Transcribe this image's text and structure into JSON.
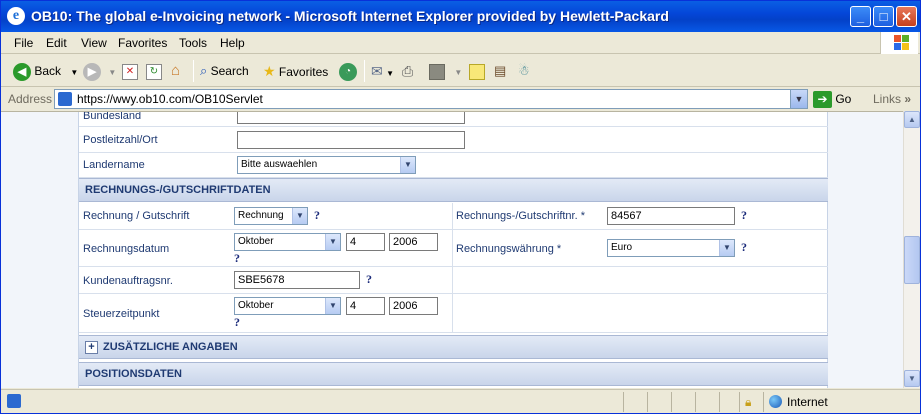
{
  "window": {
    "title": "OB10: The global e-Invoicing network - Microsoft Internet Explorer provided by Hewlett-Packard",
    "minimize": "_",
    "maximize": "□",
    "close": "✕"
  },
  "menu": [
    "File",
    "Edit",
    "View",
    "Favorites",
    "Tools",
    "Help"
  ],
  "toolbar": {
    "back": "Back",
    "search": "Search",
    "favorites": "Favorites"
  },
  "address": {
    "label": "Address",
    "url": "https://wwy.ob10.com/OB10Servlet",
    "go": "Go",
    "links": "Links"
  },
  "form": {
    "bundesland_label": "Bundesland",
    "bundesland_value": "",
    "plz_label": "Postleitzahl/Ort",
    "plz_value": "",
    "laender_label": "Landername",
    "laender_value": "Bitte auswaehlen",
    "section_rechnung": "RECHNUNGS-/GUTSCHRIFTDATEN",
    "typ_label": "Rechnung / Gutschrift",
    "typ_value": "Rechnung",
    "nr_label": "Rechnungs-/Gutschriftnr. *",
    "nr_value": "84567",
    "datum_label": "Rechnungsdatum",
    "datum_month": "Oktober",
    "datum_day": "4",
    "datum_year": "2006",
    "waehrung_label": "Rechnungswährung *",
    "waehrung_value": "Euro",
    "kunden_label": "Kundenauftragsnr.",
    "kunden_value": "SBE5678",
    "steuer_label": "Steuerzeitpunkt",
    "steuer_month": "Oktober",
    "steuer_day": "4",
    "steuer_year": "2006",
    "help": "?",
    "section_zusatz_plus": "+",
    "section_zusatz": "ZUSÄTZLICHE ANGABEN",
    "section_positionen": "POSITIONSDATEN"
  },
  "status": {
    "zone": "Internet"
  },
  "colors": {
    "titlebar": "#0446d8",
    "section_header": "#c9d5ea",
    "label_text": "#1f3a72"
  }
}
